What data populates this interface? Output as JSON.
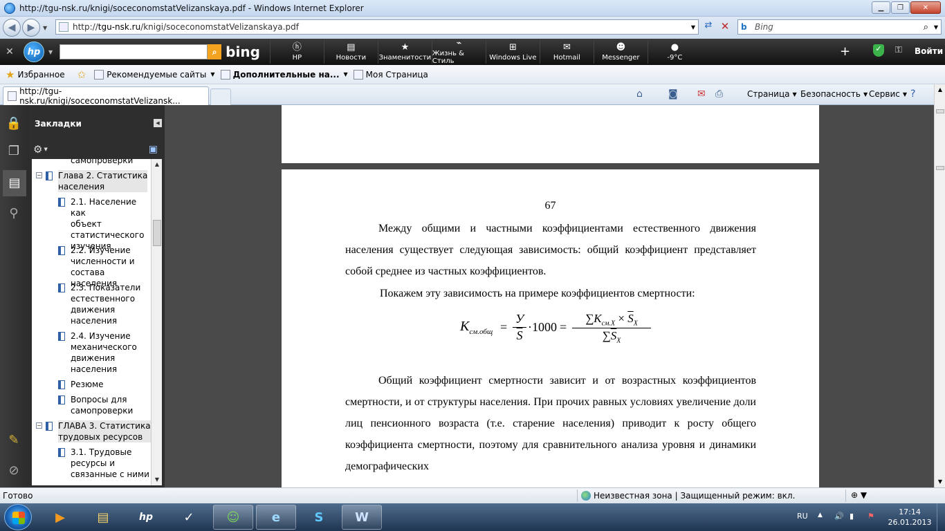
{
  "window": {
    "title": "http://tgu-nsk.ru/knigi/soceconomstatVelizanskaya.pdf - Windows Internet Explorer",
    "minimize": "▁",
    "maximize": "❐",
    "close": "✕"
  },
  "address": {
    "url_prefix": "http://",
    "url_domain": "tgu-nsk.ru",
    "url_path": "/knigi/soceconomstatVelizanskaya.pdf",
    "search_placeholder": "Bing"
  },
  "hp_toolbar": {
    "bing_label": "bing",
    "tabs": [
      {
        "label": "HP",
        "icon": "hp"
      },
      {
        "label": "Новости",
        "icon": "news"
      },
      {
        "label": "Знаменитости",
        "icon": "star"
      },
      {
        "label": "Жизнь & Стиль",
        "icon": "shoe"
      },
      {
        "label": "Windows Live",
        "icon": "windows"
      },
      {
        "label": "Hotmail",
        "icon": "mail"
      },
      {
        "label": "Messenger",
        "icon": "people"
      },
      {
        "label": "-9°C",
        "icon": "weather"
      }
    ],
    "login": "Войти"
  },
  "favorites": {
    "favorites_label": "Избранное",
    "items": [
      "Рекомендуемые сайты",
      "Дополнительные на...",
      "Моя Страница"
    ]
  },
  "tabs": {
    "active_tab": "http://tgu-nsk.ru/knigi/soceconomstatVelizansk...",
    "commands": [
      "Страница",
      "Безопасность",
      "Сервис"
    ]
  },
  "bookmarks": {
    "header": "Закладки",
    "items": [
      {
        "lines": [
          "самопроверки"
        ]
      },
      {
        "lines": [
          "Глава 2. Статистика",
          "населения"
        ],
        "level": 0,
        "expanded": true
      },
      {
        "lines": [
          "2.1. Население как",
          "объект",
          "статистического",
          "изучения"
        ],
        "level": 1
      },
      {
        "lines": [
          "2.2. Изучение",
          "численности и",
          "состава населения"
        ],
        "level": 1
      },
      {
        "lines": [
          "2.3. Показатели",
          "естественного",
          "движения",
          "населения"
        ],
        "level": 1
      },
      {
        "lines": [
          "2.4. Изучение",
          "механического",
          "движения",
          "населения"
        ],
        "level": 1
      },
      {
        "lines": [
          "Резюме"
        ],
        "level": 1
      },
      {
        "lines": [
          "Вопросы для",
          "самопроверки"
        ],
        "level": 1
      },
      {
        "lines": [
          "ГЛАВА 3. Статистика",
          "трудовых ресурсов"
        ],
        "level": 0,
        "expanded": true
      },
      {
        "lines": [
          "3.1. Трудовые",
          "ресурсы и",
          "связанные с ними"
        ],
        "level": 1
      }
    ]
  },
  "document": {
    "page_number": "67",
    "paragraph1": "Между общими и частными коэффициентами естественного движения населения существует следующая зависимость: общий коэффициент представляет собой среднее из частных коэффициентов.",
    "paragraph2": "Покажем эту зависимость на примере коэффициентов смертности:",
    "formula": {
      "lhs": "K",
      "lhs_sub": "см.общ",
      "eq": "=",
      "frac1_num": "У",
      "frac1_den": "S",
      "times_1000": "·1000",
      "sum_num": "∑K",
      "sum_num_sub": "см.X",
      "sum_num_times": "×",
      "sum_num_s": "S",
      "sum_num_s_sub": "X",
      "sum_den": "∑",
      "sum_den_s": "S",
      "sum_den_s_sub": "X"
    },
    "paragraph3": "Общий коэффициент смертности зависит и от возрастных коэффициентов смертности, и от структуры населения. При прочих равных условиях увеличение доли лиц пенсионного возраста (т.е. старение населения) приводит к росту общего коэффициента смертности, поэтому для сравнительного анализа уровня и динамики демографических"
  },
  "status": {
    "text": "Готово",
    "zone": "Неизвестная зона | Защищенный режим: вкл.",
    "zoom_icon": "zoom-icon"
  },
  "taskbar": {
    "lang": "RU",
    "time": "17:14",
    "date": "26.01.2013"
  }
}
